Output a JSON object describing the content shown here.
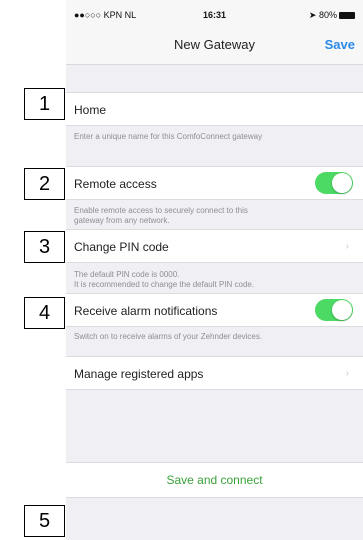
{
  "status_bar": {
    "carrier": "●●○○○ KPN NL",
    "time": "16:31",
    "battery": "80%"
  },
  "nav": {
    "title": "New Gateway",
    "save_label": "Save"
  },
  "settings": {
    "name": {
      "value": "Home",
      "footer": "Enter a unique name for this ComfoConnect gateway"
    },
    "remote_access": {
      "label": "Remote access",
      "on": true,
      "footer_line1": "Enable remote access to securely connect to this",
      "footer_line2": "gateway from any network."
    },
    "pin": {
      "label": "Change PIN code",
      "footer_line1": "The default PIN code is 0000.",
      "footer_line2": "It is recommended to change the default PIN code."
    },
    "alarms": {
      "label": "Receive alarm notifications",
      "on": true,
      "footer": "Switch on to receive alarms of your Zehnder devices."
    },
    "apps": {
      "label": "Manage registered apps"
    }
  },
  "save_connect_label": "Save and connect",
  "annotations": [
    "1",
    "2",
    "3",
    "4",
    "5"
  ],
  "colors": {
    "accent": "#2b8ae8",
    "toggle_on": "#4cd964",
    "action_green": "#3aa33a"
  }
}
